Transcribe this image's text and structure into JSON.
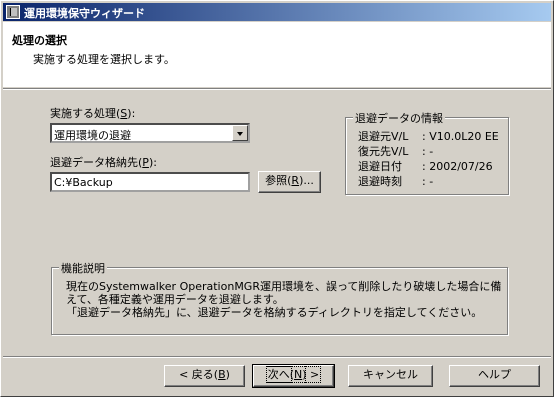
{
  "window": {
    "title": "運用環境保守ウィザード"
  },
  "header": {
    "title": "処理の選択",
    "subtitle": "実施する処理を選択します。"
  },
  "form": {
    "process": {
      "label": "実施する処理",
      "accel": "S",
      "selected": "運用環境の退避"
    },
    "destination": {
      "label": "退避データ格納先",
      "accel": "P",
      "value": "C:¥Backup"
    },
    "browse_button": {
      "label": "参照",
      "accel": "R",
      "suffix": "..."
    }
  },
  "info": {
    "title": "退避データの情報",
    "rows": [
      {
        "key": "退避元V/L",
        "value": ": V10.0L20 EE"
      },
      {
        "key": "復元先V/L",
        "value": ": -"
      },
      {
        "key": "退避日付",
        "value": ": 2002/07/26"
      },
      {
        "key": "退避時刻",
        "value": ": -"
      }
    ]
  },
  "description": {
    "title": "機能説明",
    "line1": "現在のSystemwalker OperationMGR運用環境を、誤って削除したり破壊した場合に備えて、各種定義や運用データを退避します。",
    "line2": "「退避データ格納先」に、退避データを格納するディレクトリを指定してください。"
  },
  "buttons": {
    "back": {
      "label": "< 戻る",
      "accel": "B"
    },
    "next": {
      "label": "次へ",
      "accel": "N",
      "suffix": " >"
    },
    "cancel": {
      "label": "キャンセル"
    },
    "help": {
      "label": "ヘルプ"
    }
  }
}
